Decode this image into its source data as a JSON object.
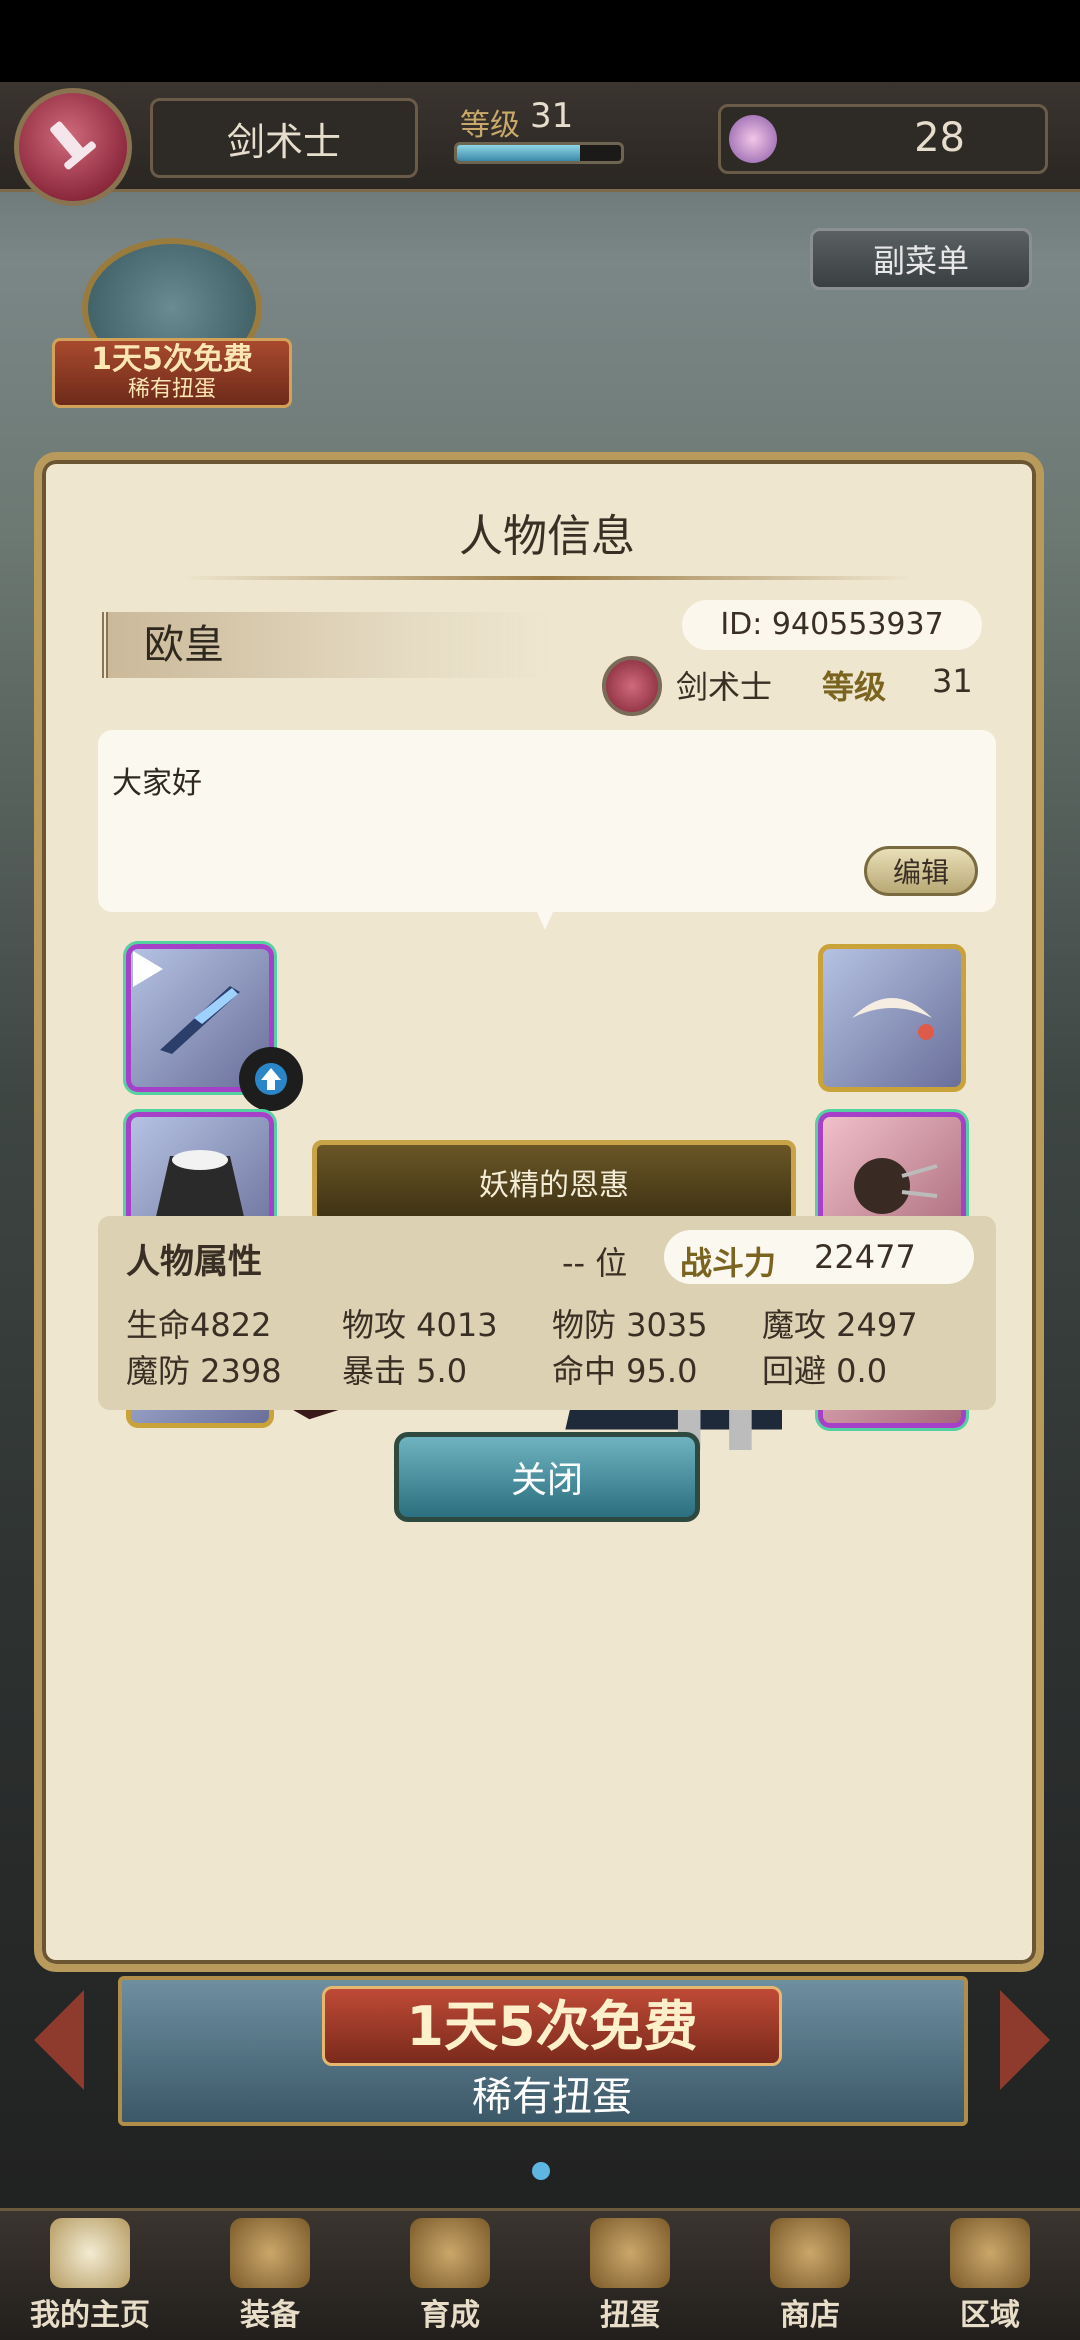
{
  "header": {
    "class_name": "剑术士",
    "level_label": "等级",
    "level_value": "31",
    "level_progress": 0.75,
    "gems": "28",
    "submenu_label": "副菜单"
  },
  "gacha_badge": {
    "line1": "1天5次免费",
    "line2": "稀有扭蛋"
  },
  "panel": {
    "title": "人物信息",
    "player_name": "欧皇",
    "player_id": "ID:  940553937",
    "class_name": "剑术士",
    "level_label": "等级",
    "level_value": "31",
    "greeting": "大家好",
    "edit_label": "编辑",
    "fairy_button": "妖精的恩惠",
    "stats": {
      "title": "人物属性",
      "rank": "-- 位",
      "power_label": "战斗力",
      "power_value": "22477",
      "hp": "生命4822",
      "patk": "物攻 4013",
      "pdef": "物防 3035",
      "matk": "魔攻 2497",
      "mdef": "魔防 2398",
      "crit": "暴击 5.0",
      "hit": "命中 95.0",
      "dodge": "回避 0.0"
    },
    "close_label": "关闭"
  },
  "promo": {
    "line1": "1天5次免费",
    "line2": "稀有扭蛋"
  },
  "nav": {
    "items": [
      {
        "label": "我的主页",
        "icon": "home-scroll-icon"
      },
      {
        "label": "装备",
        "icon": "helmet-icon"
      },
      {
        "label": "育成",
        "icon": "swords-icon"
      },
      {
        "label": "扭蛋",
        "icon": "gacha-machine-icon"
      },
      {
        "label": "商店",
        "icon": "coin-bag-icon"
      },
      {
        "label": "区域",
        "icon": "globe-icon"
      }
    ]
  },
  "colors": {
    "panel_bg": "#efe6cf",
    "accent_gold": "#b89a5c",
    "rare_border": "#a740c9",
    "close_button": "#2b6f80"
  }
}
